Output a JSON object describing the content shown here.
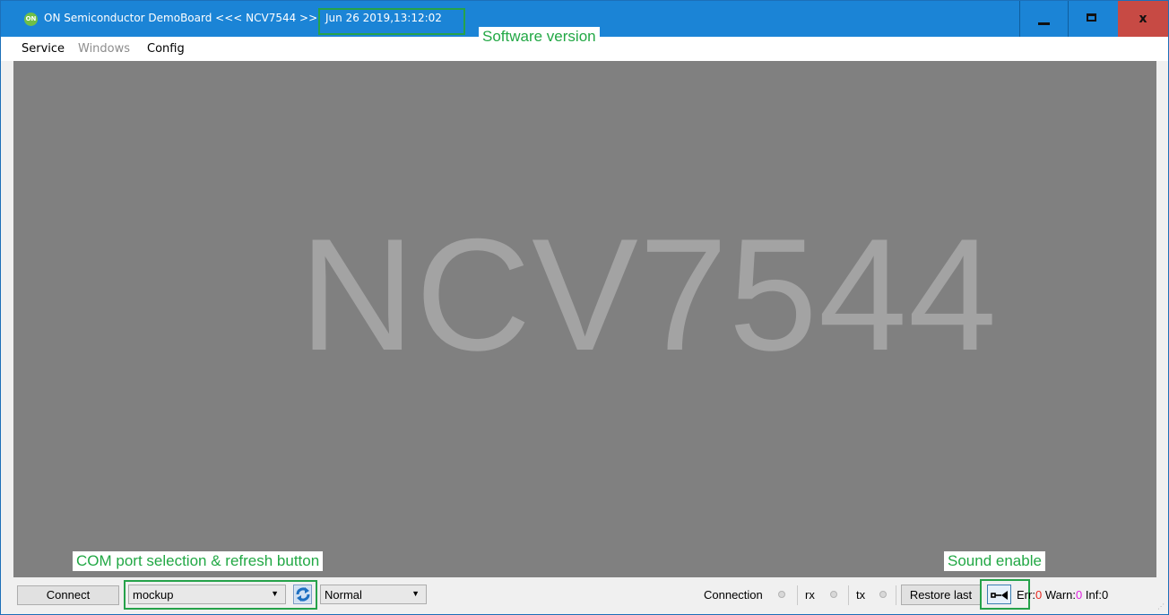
{
  "window": {
    "title": "ON Semiconductor DemoBoard <<< NCV7544 >>",
    "version_date": "Jun 26 2019,13:12:02",
    "logo_text": "ON",
    "logo_icon": "on-semiconductor-logo",
    "minimize_icon": "minimize-icon",
    "maximize_icon": "maximize-icon",
    "close_label": "x"
  },
  "annotations": {
    "software_version": "Software version",
    "com_port": "COM port selection & refresh button",
    "sound_enable": "Sound enable",
    "highlight_color": "#26a24a"
  },
  "menu": {
    "items": [
      {
        "label": "Service",
        "enabled": true
      },
      {
        "label": "Windows",
        "enabled": false
      },
      {
        "label": "Config",
        "enabled": true
      }
    ]
  },
  "main": {
    "watermark": "NCV7544",
    "background": "#808080"
  },
  "statusbar": {
    "connect_label": "Connect",
    "port_value": "mockup",
    "mode_value": "Normal",
    "refresh_icon": "refresh-icon",
    "connection_label": "Connection",
    "rx_label": "rx",
    "tx_label": "tx",
    "restore_label": "Restore last",
    "sound_icon": "speaker-icon",
    "err_label": "Err:",
    "err_value": "0",
    "warn_label": "Warn:",
    "warn_value": "0",
    "inf_label": "Inf:",
    "inf_value": "0",
    "err_color": "#e8271f",
    "warn_color": "#e020e0"
  }
}
